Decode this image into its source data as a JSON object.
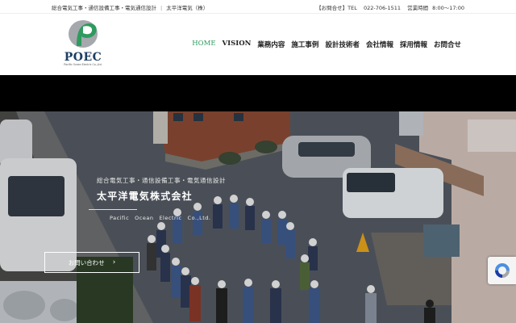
{
  "topbar": {
    "services": "総合電気工事・通信設備工事・電気通信設計",
    "company": "太平洋電気（株）",
    "contact_label": "【お問合せ】TEL",
    "phone": "022-706-1511",
    "hours_label": "営業時間",
    "hours": "8:00～17:00"
  },
  "logo": {
    "wordmark": "POEC",
    "subtitle": "Pacific Ocean Electric Co.,Ltd."
  },
  "nav": {
    "items": [
      {
        "label": "HOME"
      },
      {
        "label": "VISION"
      },
      {
        "label": "業務内容"
      },
      {
        "label": "施工事例"
      },
      {
        "label": "設計技術者"
      },
      {
        "label": "会社情報"
      },
      {
        "label": "採用情報"
      },
      {
        "label": "お問合せ"
      }
    ]
  },
  "hero": {
    "tagline": "総合電気工事・通信設備工事・電気通信設計",
    "company": "太平洋電気株式会社",
    "company_en": "Pacific　Ocean　Electric　Co.,Ltd.",
    "cta_label": "お問い合わせ",
    "cta_arrow": "›"
  },
  "colors": {
    "accent": "#2e9b5e",
    "logo_navy": "#1d3e63",
    "band": "#000000"
  },
  "icons": {
    "recaptcha": "recaptcha-icon"
  }
}
